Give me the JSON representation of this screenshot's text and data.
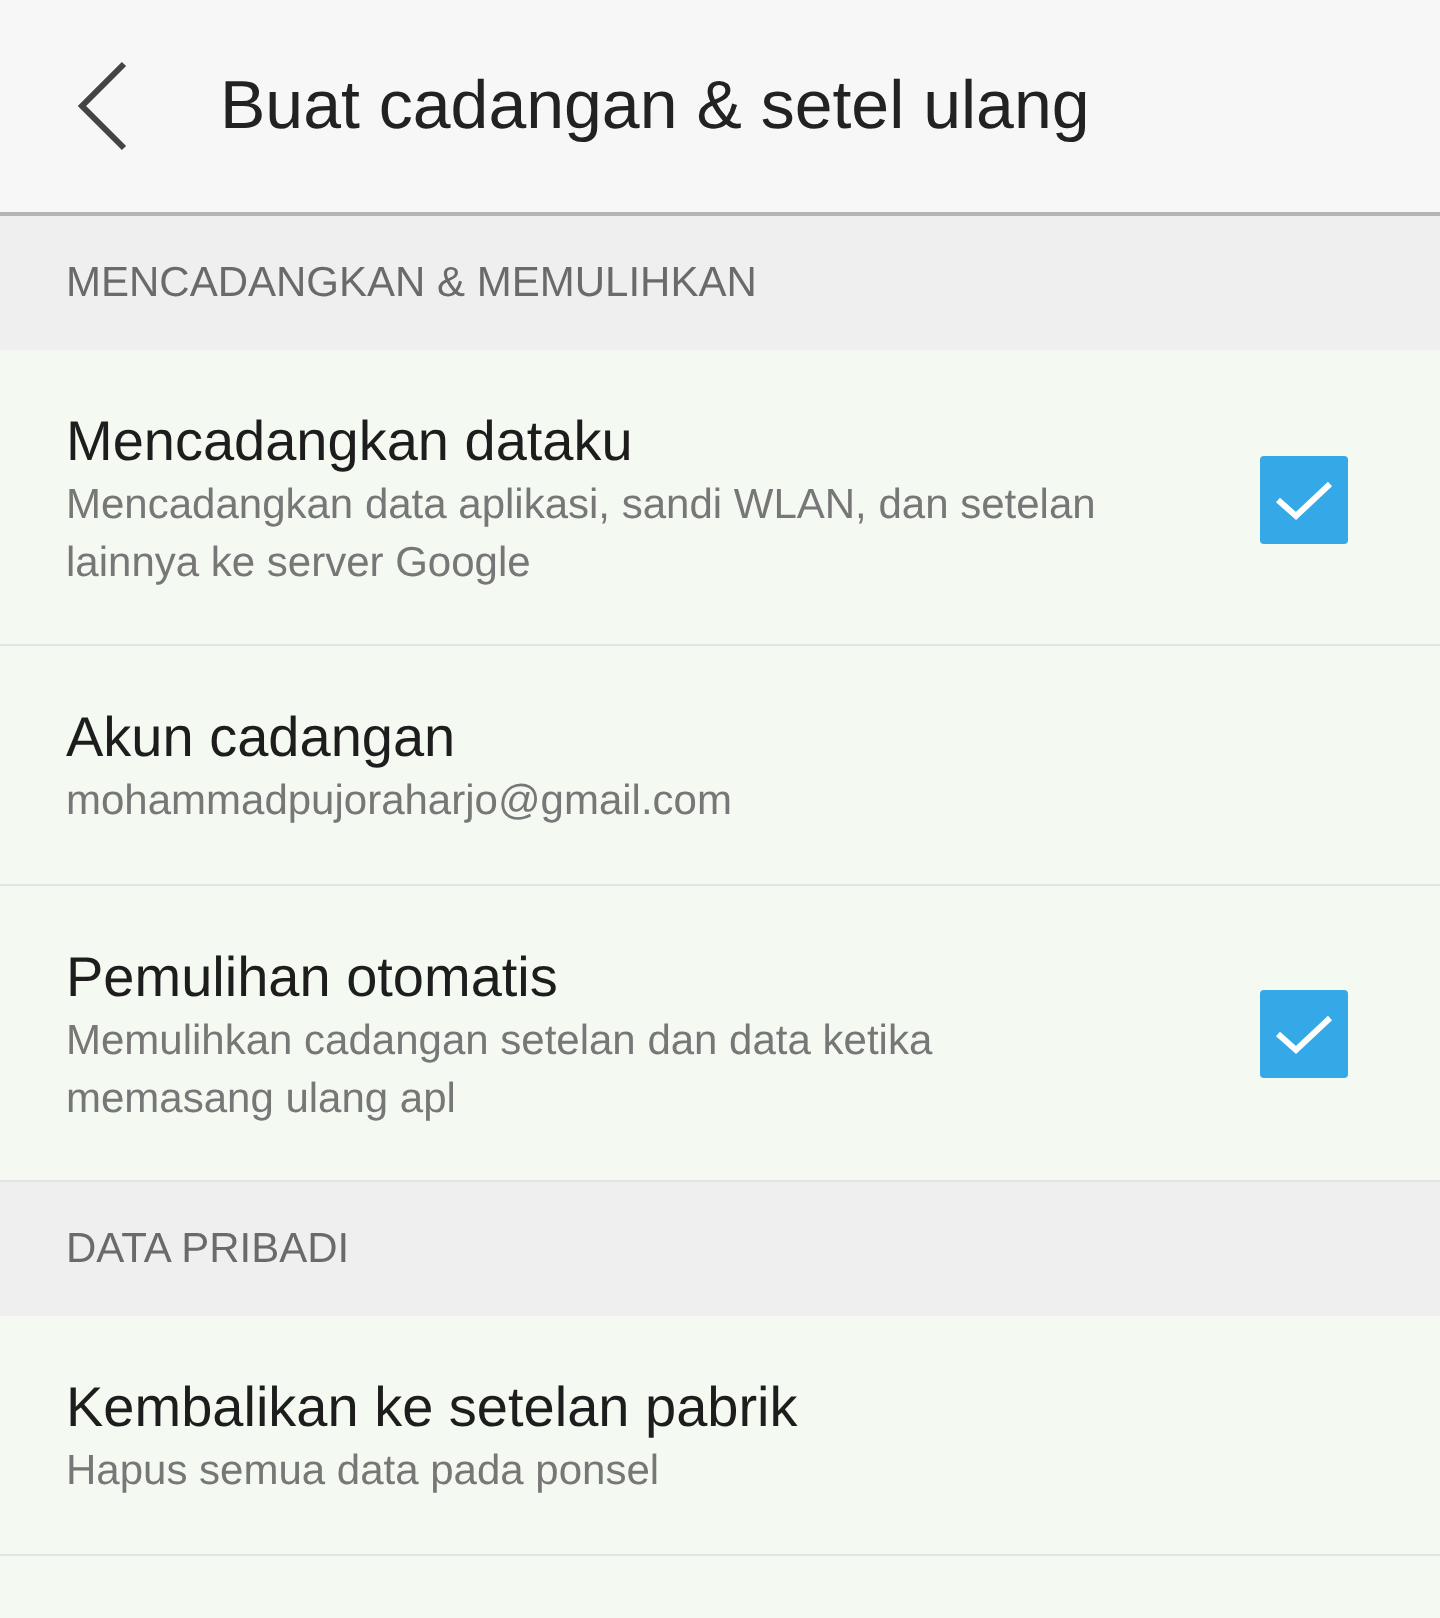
{
  "header": {
    "title": "Buat cadangan & setel ulang"
  },
  "sections": [
    {
      "title": "MENCADANGKAN & MEMULIHKAN",
      "items": [
        {
          "kind": "check",
          "title": "Mencadangkan dataku",
          "subtitle": "Mencadangkan data aplikasi, sandi WLAN, dan setelan lainnya ke server Google",
          "checked": true
        },
        {
          "kind": "plain",
          "title": "Akun cadangan",
          "subtitle": "mohammadpujoraharjo@gmail.com"
        },
        {
          "kind": "check",
          "title": "Pemulihan otomatis",
          "subtitle": "Memulihkan cadangan setelan dan data ketika memasang ulang apl",
          "checked": true
        }
      ]
    },
    {
      "title": "DATA PRIBADI",
      "items": [
        {
          "kind": "plain",
          "title": "Kembalikan ke setelan pabrik",
          "subtitle": "Hapus semua data pada ponsel"
        }
      ]
    }
  ]
}
